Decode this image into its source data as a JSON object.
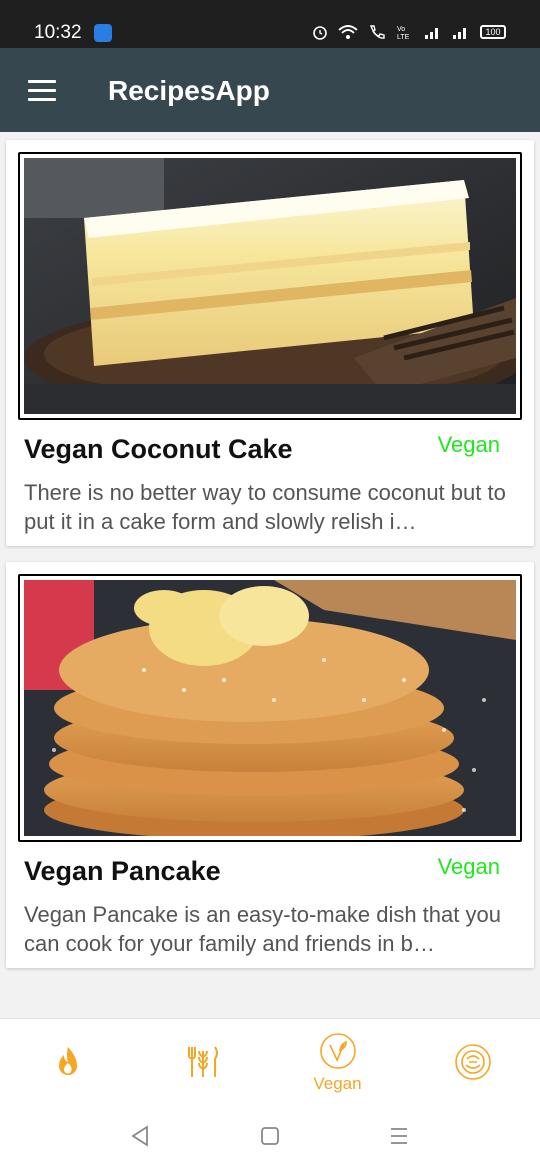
{
  "status_bar": {
    "time": "10:32",
    "battery": "100",
    "icons": [
      "alarm-icon",
      "wifi-icon",
      "call-icon",
      "volte-icon",
      "signal-icon",
      "signal-icon",
      "battery-icon"
    ]
  },
  "app_bar": {
    "title": "RecipesApp",
    "menu_icon": "menu-icon"
  },
  "recipes": [
    {
      "title": "Vegan Coconut Cake",
      "tag": "Vegan",
      "description": "There is no better way to consume coconut but to put it in a cake form and slowly relish i…"
    },
    {
      "title": "Vegan Pancake",
      "tag": "Vegan",
      "description": "Vegan Pancake is an easy-to-make dish that you can cook for your family and friends in b…"
    }
  ],
  "bottom_nav": {
    "items": [
      {
        "icon": "flame-icon",
        "label": ""
      },
      {
        "icon": "utensils-wheat-icon",
        "label": ""
      },
      {
        "icon": "vegan-icon",
        "label": "Vegan"
      },
      {
        "icon": "dish-icon",
        "label": ""
      }
    ],
    "active_index": 2
  },
  "colors": {
    "app_bar": "#37474f",
    "accent": "#f5a623",
    "tag": "#1ee81e"
  }
}
